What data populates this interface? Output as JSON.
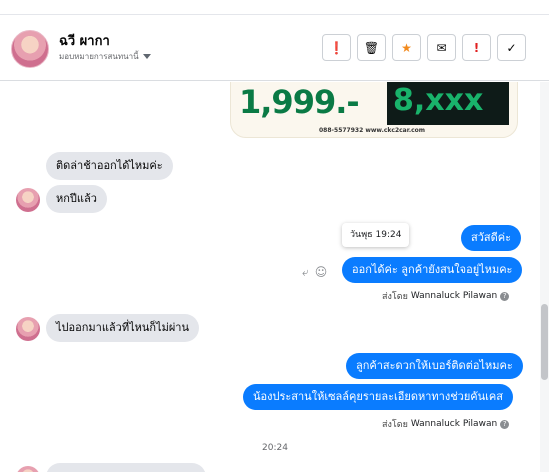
{
  "header": {
    "contact_name": "ฉวี ผากา",
    "assign_label": "มอบหมายการสนทนานี้",
    "actions": [
      {
        "name": "spam-button",
        "glyph": "❗",
        "style": ""
      },
      {
        "name": "delete-button",
        "glyph": "🗑",
        "style": ""
      },
      {
        "name": "star-button",
        "glyph": "★",
        "style": "orange"
      },
      {
        "name": "email-button",
        "glyph": "✉",
        "style": ""
      },
      {
        "name": "important-button",
        "glyph": "!",
        "style": "red"
      },
      {
        "name": "done-button",
        "glyph": "✓",
        "style": ""
      }
    ]
  },
  "ad": {
    "price": "1,999.-",
    "price2": "8,xxx",
    "contact": "088-5577932 www.ckc2car.com"
  },
  "messages": {
    "in1": "ติดล่าช้าออกได้ไหมค่ะ",
    "in2": "หกปีแล้ว",
    "tooltip": "วันพุธ 19:24",
    "out1": "สวัสดีค่ะ",
    "out2": "ออกได้ค่ะ ลูกค้ายังสนใจอยู่ไหมคะ",
    "in3": "ไปออกมาแล้วที่ไหนก็ไม่ผ่าน",
    "out3": "ลูกค้าสะดวกให้เบอร์ติดต่อไหมคะ",
    "out4": "น้องประสานให้เซลล์คุยรายละเอียดหาทางช่วยคันเคส",
    "timestamp": "20:24"
  },
  "sent_by": {
    "prefix": "ส่งโดย",
    "agent": "Wannaluck Pilawan"
  }
}
